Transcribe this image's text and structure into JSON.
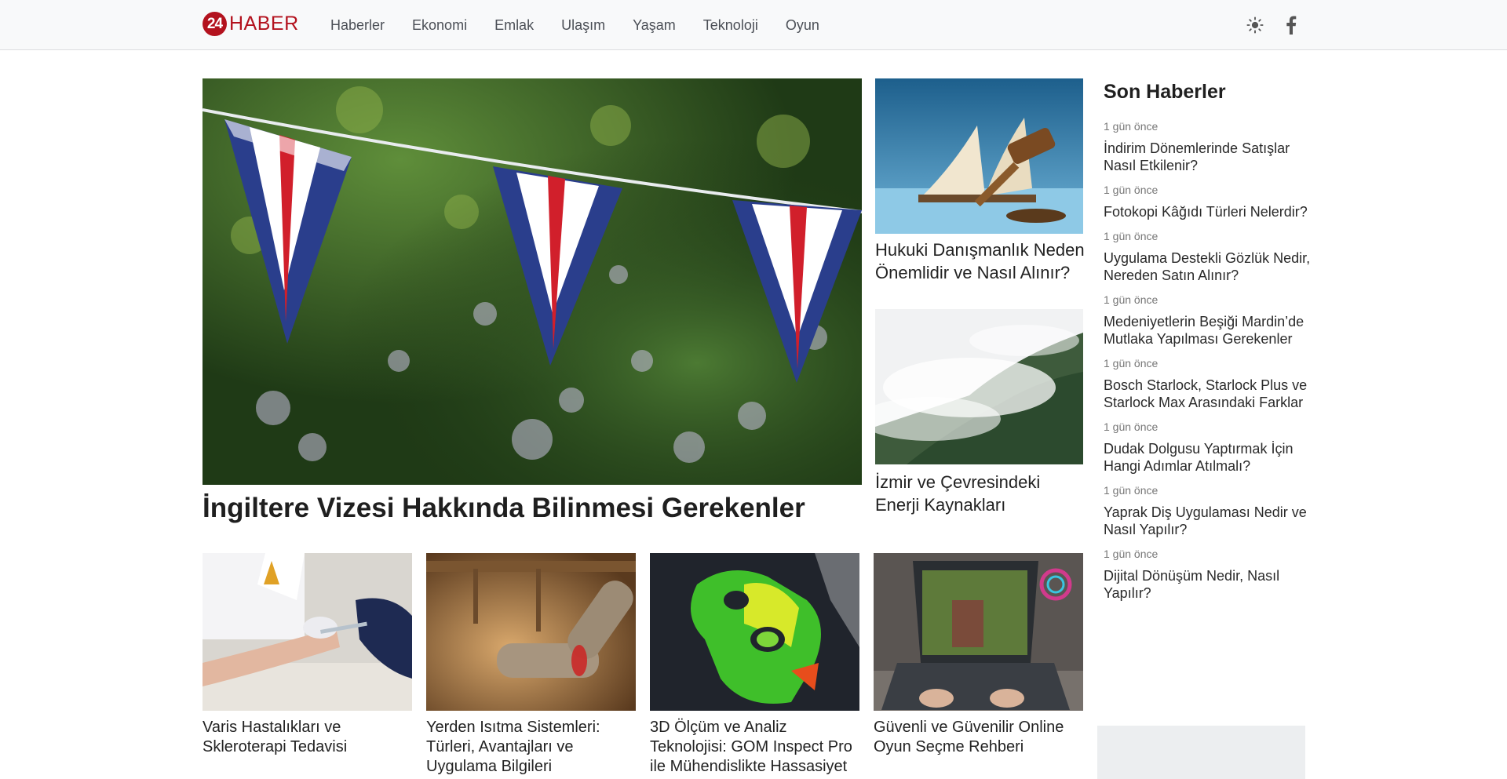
{
  "header": {
    "logo_number": "24",
    "logo_text": "HABER",
    "nav": [
      "Haberler",
      "Ekonomi",
      "Emlak",
      "Ulaşım",
      "Yaşam",
      "Teknoloji",
      "Oyun"
    ],
    "icons": [
      "sun-icon",
      "facebook-icon"
    ]
  },
  "main_story": {
    "title": "İngiltere Vizesi Hakkında Bilinmesi Gerekenler",
    "image": "union-jack-bunting"
  },
  "side_stories": [
    {
      "title": "Hukuki Danışmanlık Neden Önemlidir ve Nasıl Alınır?",
      "image": "book-and-gavel"
    },
    {
      "title": "İzmir ve Çevresindeki Enerji Kaynakları",
      "image": "misty-forest-hill"
    }
  ],
  "cards": [
    {
      "title": "Varis Hastalıkları ve Skleroterapi Tedavisi",
      "image": "injection-arm"
    },
    {
      "title": "Yerden Isıtma Sistemleri: Türleri, Avantajları ve Uygulama Bilgileri",
      "image": "heating-pipes"
    },
    {
      "title": "3D Ölçüm ve Analiz Teknolojisi: GOM Inspect Pro ile Mühendislikte Hassasiyet",
      "image": "3d-scan-part"
    },
    {
      "title": "Güvenli ve Güvenilir Online Oyun Seçme Rehberi",
      "image": "gaming-laptop"
    }
  ],
  "sidebar": {
    "heading": "Son Haberler",
    "items": [
      {
        "time": "1 gün önce",
        "title": "İndirim Dönemlerinde Satışlar Nasıl Etkilenir?"
      },
      {
        "time": "1 gün önce",
        "title": "Fotokopi Kâğıdı Türleri Nelerdir?"
      },
      {
        "time": "1 gün önce",
        "title": "Uygulama Destekli Gözlük Nedir, Nereden Satın Alınır?"
      },
      {
        "time": "1 gün önce",
        "title": "Medeniyetlerin Beşiği Mardin’de Mutlaka Yapılması Gerekenler"
      },
      {
        "time": "1 gün önce",
        "title": "Bosch Starlock, Starlock Plus ve Starlock Max Arasındaki Farklar"
      },
      {
        "time": "1 gün önce",
        "title": "Dudak Dolgusu Yaptırmak İçin Hangi Adımlar Atılmalı?"
      },
      {
        "time": "1 gün önce",
        "title": "Yaprak Diş Uygulaması Nedir ve Nasıl Yapılır?"
      },
      {
        "time": "1 gün önce",
        "title": "Dijital Dönüşüm Nedir, Nasıl Yapılır?"
      }
    ]
  }
}
